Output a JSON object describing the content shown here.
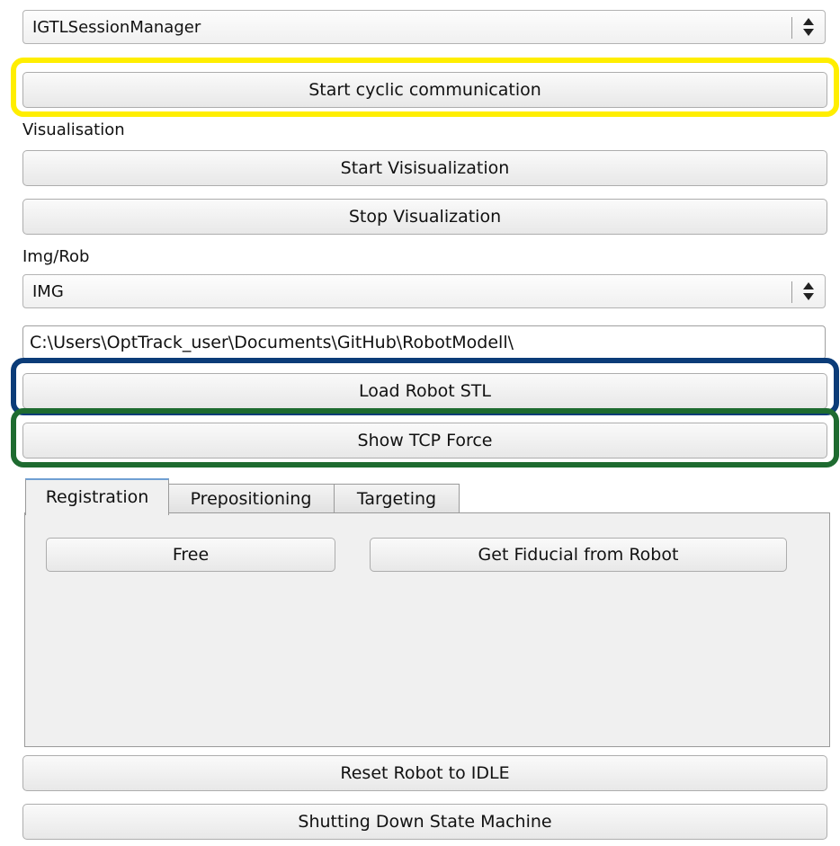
{
  "session_combo": {
    "value": "IGTLSessionManager"
  },
  "cyclic_button": {
    "label": "Start cyclic communication"
  },
  "visualisation": {
    "heading": "Visualisation",
    "start_label": "Start Visisualization",
    "stop_label": "Stop Visualization"
  },
  "img_rob": {
    "heading": "Img/Rob",
    "value": "IMG"
  },
  "path_field": {
    "value": "C:\\Users\\OptTrack_user\\Documents\\GitHub\\RobotModell\\"
  },
  "load_stl_button": {
    "label": "Load Robot STL"
  },
  "tcp_force_button": {
    "label": "Show TCP Force"
  },
  "tabs": [
    {
      "label": "Registration",
      "active": true
    },
    {
      "label": "Prepositioning",
      "active": false
    },
    {
      "label": "Targeting",
      "active": false
    }
  ],
  "registration_panel": {
    "free_label": "Free",
    "fiducial_label": "Get Fiducial from Robot"
  },
  "reset_button": {
    "label": "Reset Robot to IDLE"
  },
  "shutdown_button": {
    "label": "Shutting Down State Machine"
  },
  "highlight_colors": {
    "cyclic": "#ffee00",
    "load_stl": "#0b3c78",
    "tcp_force": "#1e6b30"
  },
  "icons": {
    "combo_arrows": "up-down-arrows-icon"
  }
}
